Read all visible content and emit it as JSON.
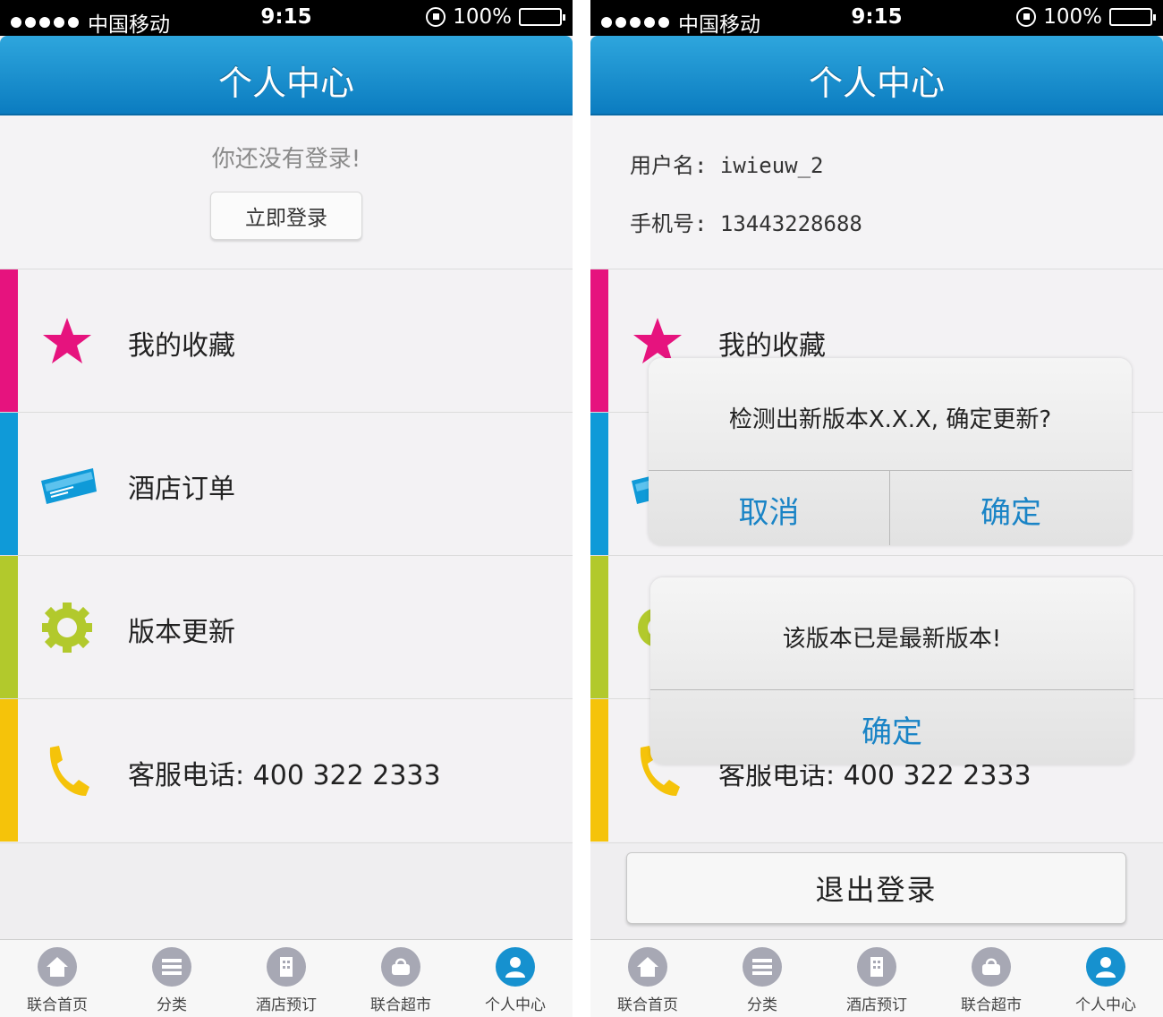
{
  "status_bar": {
    "carrier": "中国移动",
    "time": "9:15",
    "battery": "100%"
  },
  "nav": {
    "title": "个人中心"
  },
  "login": {
    "message": "你还没有登录!",
    "button": "立即登录"
  },
  "user": {
    "username_line": "用户名: iwieuw_2",
    "phone_line": "手机号: 13443228688"
  },
  "menu": {
    "items": [
      {
        "label": "我的收藏",
        "color": "#e6137e",
        "icon": "star-icon"
      },
      {
        "label": "酒店订单",
        "color": "#0f9ad8",
        "icon": "ticket-icon"
      },
      {
        "label": "版本更新",
        "color": "#b2c92c",
        "icon": "gear-icon"
      },
      {
        "label": "客服电话: 400  322  2333",
        "color": "#f5c30a",
        "icon": "phone-icon"
      }
    ]
  },
  "logout": {
    "button": "退出登录"
  },
  "dialogs": {
    "update": {
      "message": "检测出新版本X.X.X, 确定更新?",
      "cancel": "取消",
      "confirm": "确定"
    },
    "latest": {
      "message": "该版本已是最新版本!",
      "confirm": "确定"
    }
  },
  "tabs": [
    {
      "label": "联合首页",
      "icon": "home-icon"
    },
    {
      "label": "分类",
      "icon": "list-icon"
    },
    {
      "label": "酒店预订",
      "icon": "building-icon"
    },
    {
      "label": "联合超市",
      "icon": "basket-icon"
    },
    {
      "label": "个人中心",
      "icon": "person-icon",
      "active": true
    }
  ]
}
